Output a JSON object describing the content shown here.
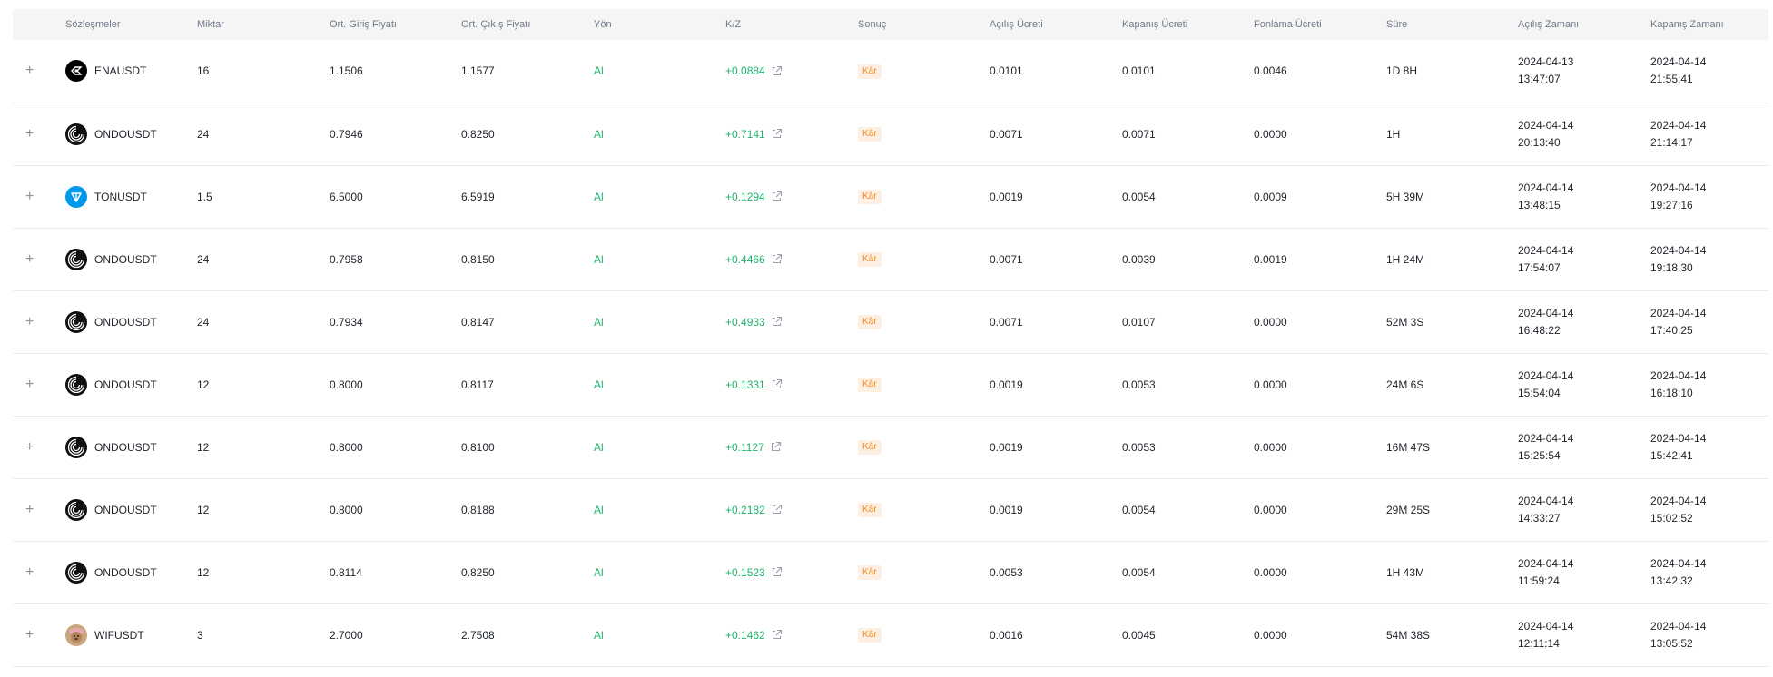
{
  "columns": [
    "Sözleşmeler",
    "Miktar",
    "Ort. Giriş Fiyatı",
    "Ort. Çıkış Fiyatı",
    "Yön",
    "K/Z",
    "Sonuç",
    "Açılış Ücreti",
    "Kapanış Ücreti",
    "Fonlama Ücreti",
    "Süre",
    "Açılış Zamanı",
    "Kapanış Zamanı"
  ],
  "expand_symbol": "+",
  "rows": [
    {
      "icon": "ena-coin-icon",
      "symbol": "ENAUSDT",
      "qty": "16",
      "entry": "1.1506",
      "exit": "1.1577",
      "side": "Al",
      "pnl": "+0.0884",
      "result": "Kâr",
      "open_fee": "0.0101",
      "close_fee": "0.0101",
      "funding_fee": "0.0046",
      "duration": "1D 8H",
      "open_date": "2024-04-13",
      "open_time": "13:47:07",
      "close_date": "2024-04-14",
      "close_time": "21:55:41"
    },
    {
      "icon": "ondo-coin-icon",
      "symbol": "ONDOUSDT",
      "qty": "24",
      "entry": "0.7946",
      "exit": "0.8250",
      "side": "Al",
      "pnl": "+0.7141",
      "result": "Kâr",
      "open_fee": "0.0071",
      "close_fee": "0.0071",
      "funding_fee": "0.0000",
      "duration": "1H",
      "open_date": "2024-04-14",
      "open_time": "20:13:40",
      "close_date": "2024-04-14",
      "close_time": "21:14:17"
    },
    {
      "icon": "ton-coin-icon",
      "symbol": "TONUSDT",
      "qty": "1.5",
      "entry": "6.5000",
      "exit": "6.5919",
      "side": "Al",
      "pnl": "+0.1294",
      "result": "Kâr",
      "open_fee": "0.0019",
      "close_fee": "0.0054",
      "funding_fee": "0.0009",
      "duration": "5H 39M",
      "open_date": "2024-04-14",
      "open_time": "13:48:15",
      "close_date": "2024-04-14",
      "close_time": "19:27:16"
    },
    {
      "icon": "ondo-coin-icon",
      "symbol": "ONDOUSDT",
      "qty": "24",
      "entry": "0.7958",
      "exit": "0.8150",
      "side": "Al",
      "pnl": "+0.4466",
      "result": "Kâr",
      "open_fee": "0.0071",
      "close_fee": "0.0039",
      "funding_fee": "0.0019",
      "duration": "1H 24M",
      "open_date": "2024-04-14",
      "open_time": "17:54:07",
      "close_date": "2024-04-14",
      "close_time": "19:18:30"
    },
    {
      "icon": "ondo-coin-icon",
      "symbol": "ONDOUSDT",
      "qty": "24",
      "entry": "0.7934",
      "exit": "0.8147",
      "side": "Al",
      "pnl": "+0.4933",
      "result": "Kâr",
      "open_fee": "0.0071",
      "close_fee": "0.0107",
      "funding_fee": "0.0000",
      "duration": "52M 3S",
      "open_date": "2024-04-14",
      "open_time": "16:48:22",
      "close_date": "2024-04-14",
      "close_time": "17:40:25"
    },
    {
      "icon": "ondo-coin-icon",
      "symbol": "ONDOUSDT",
      "qty": "12",
      "entry": "0.8000",
      "exit": "0.8117",
      "side": "Al",
      "pnl": "+0.1331",
      "result": "Kâr",
      "open_fee": "0.0019",
      "close_fee": "0.0053",
      "funding_fee": "0.0000",
      "duration": "24M 6S",
      "open_date": "2024-04-14",
      "open_time": "15:54:04",
      "close_date": "2024-04-14",
      "close_time": "16:18:10"
    },
    {
      "icon": "ondo-coin-icon",
      "symbol": "ONDOUSDT",
      "qty": "12",
      "entry": "0.8000",
      "exit": "0.8100",
      "side": "Al",
      "pnl": "+0.1127",
      "result": "Kâr",
      "open_fee": "0.0019",
      "close_fee": "0.0053",
      "funding_fee": "0.0000",
      "duration": "16M 47S",
      "open_date": "2024-04-14",
      "open_time": "15:25:54",
      "close_date": "2024-04-14",
      "close_time": "15:42:41"
    },
    {
      "icon": "ondo-coin-icon",
      "symbol": "ONDOUSDT",
      "qty": "12",
      "entry": "0.8000",
      "exit": "0.8188",
      "side": "Al",
      "pnl": "+0.2182",
      "result": "Kâr",
      "open_fee": "0.0019",
      "close_fee": "0.0054",
      "funding_fee": "0.0000",
      "duration": "29M 25S",
      "open_date": "2024-04-14",
      "open_time": "14:33:27",
      "close_date": "2024-04-14",
      "close_time": "15:02:52"
    },
    {
      "icon": "ondo-coin-icon",
      "symbol": "ONDOUSDT",
      "qty": "12",
      "entry": "0.8114",
      "exit": "0.8250",
      "side": "Al",
      "pnl": "+0.1523",
      "result": "Kâr",
      "open_fee": "0.0053",
      "close_fee": "0.0054",
      "funding_fee": "0.0000",
      "duration": "1H 43M",
      "open_date": "2024-04-14",
      "open_time": "11:59:24",
      "close_date": "2024-04-14",
      "close_time": "13:42:32"
    },
    {
      "icon": "wif-coin-icon",
      "symbol": "WIFUSDT",
      "qty": "3",
      "entry": "2.7000",
      "exit": "2.7508",
      "side": "Al",
      "pnl": "+0.1462",
      "result": "Kâr",
      "open_fee": "0.0016",
      "close_fee": "0.0045",
      "funding_fee": "0.0000",
      "duration": "54M 38S",
      "open_date": "2024-04-14",
      "open_time": "12:11:14",
      "close_date": "2024-04-14",
      "close_time": "13:05:52"
    }
  ],
  "colors": {
    "profit_green": "#20b26c",
    "badge_orange": "#f08a24",
    "badge_bg": "#fdf0e2",
    "header_bg": "#f5f5f5",
    "header_text": "#707a8a"
  }
}
